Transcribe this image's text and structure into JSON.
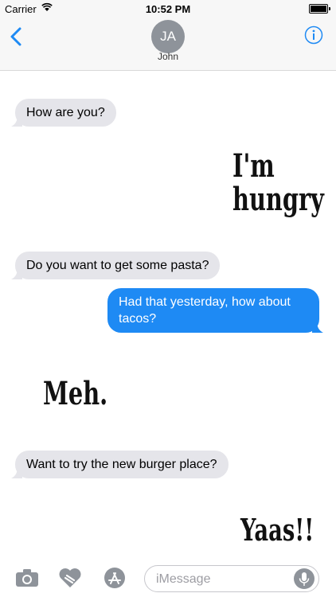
{
  "status_bar": {
    "carrier": "Carrier",
    "time": "10:52 PM"
  },
  "header": {
    "avatar_initials": "JA",
    "contact_name": "John"
  },
  "messages": [
    {
      "direction": "incoming",
      "text": "How are you?"
    },
    {
      "direction": "sticker",
      "text": "I'm hungry"
    },
    {
      "direction": "incoming",
      "text": "Do you want to get some pasta?"
    },
    {
      "direction": "outgoing",
      "text": "Had that yesterday, how about tacos?"
    },
    {
      "direction": "sticker",
      "text": "Meh."
    },
    {
      "direction": "incoming",
      "text": "Want to try the new burger place?"
    },
    {
      "direction": "sticker",
      "text": "Yaas!!"
    }
  ],
  "composer": {
    "placeholder": "iMessage"
  },
  "icons": [
    "back-chevron-icon",
    "info-icon",
    "camera-icon",
    "digital-touch-icon",
    "app-store-icon",
    "microphone-icon"
  ],
  "colors": {
    "accent": "#1e8af4",
    "incoming_bubble": "#e5e5ea",
    "avatar": "#8e939a"
  }
}
